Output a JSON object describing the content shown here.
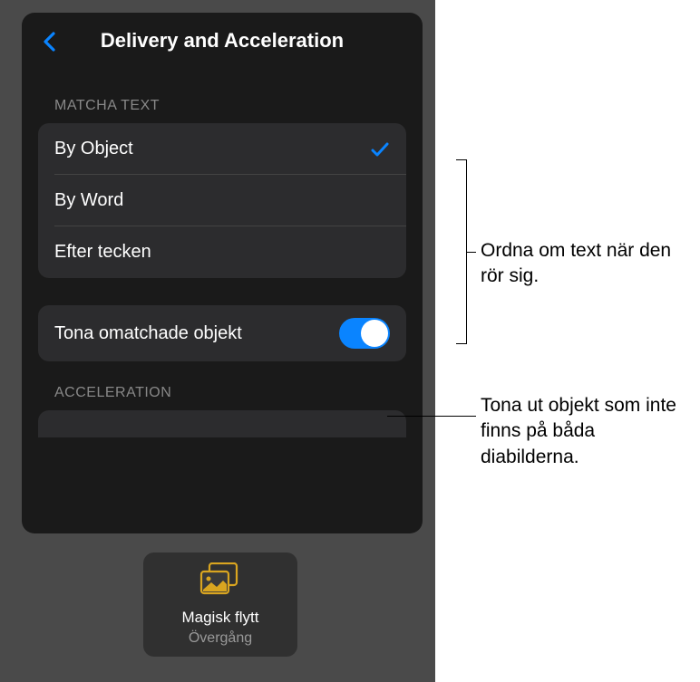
{
  "popover": {
    "title": "Delivery and Acceleration",
    "sections": {
      "matchText": {
        "header": "MATCHA TEXT",
        "items": [
          {
            "label": "By Object",
            "selected": true
          },
          {
            "label": "By Word",
            "selected": false
          },
          {
            "label": "Efter tecken",
            "selected": false
          }
        ]
      },
      "fadeToggle": {
        "label": "Tona omatchade objekt",
        "value": true
      },
      "acceleration": {
        "header": "ACCELERATION"
      }
    }
  },
  "transitionChip": {
    "title": "Magisk flytt",
    "subtitle": "Övergång"
  },
  "annotations": {
    "a1": "Ordna om text när den rör sig.",
    "a2": "Tona ut objekt som inte finns på båda diabilderna."
  }
}
